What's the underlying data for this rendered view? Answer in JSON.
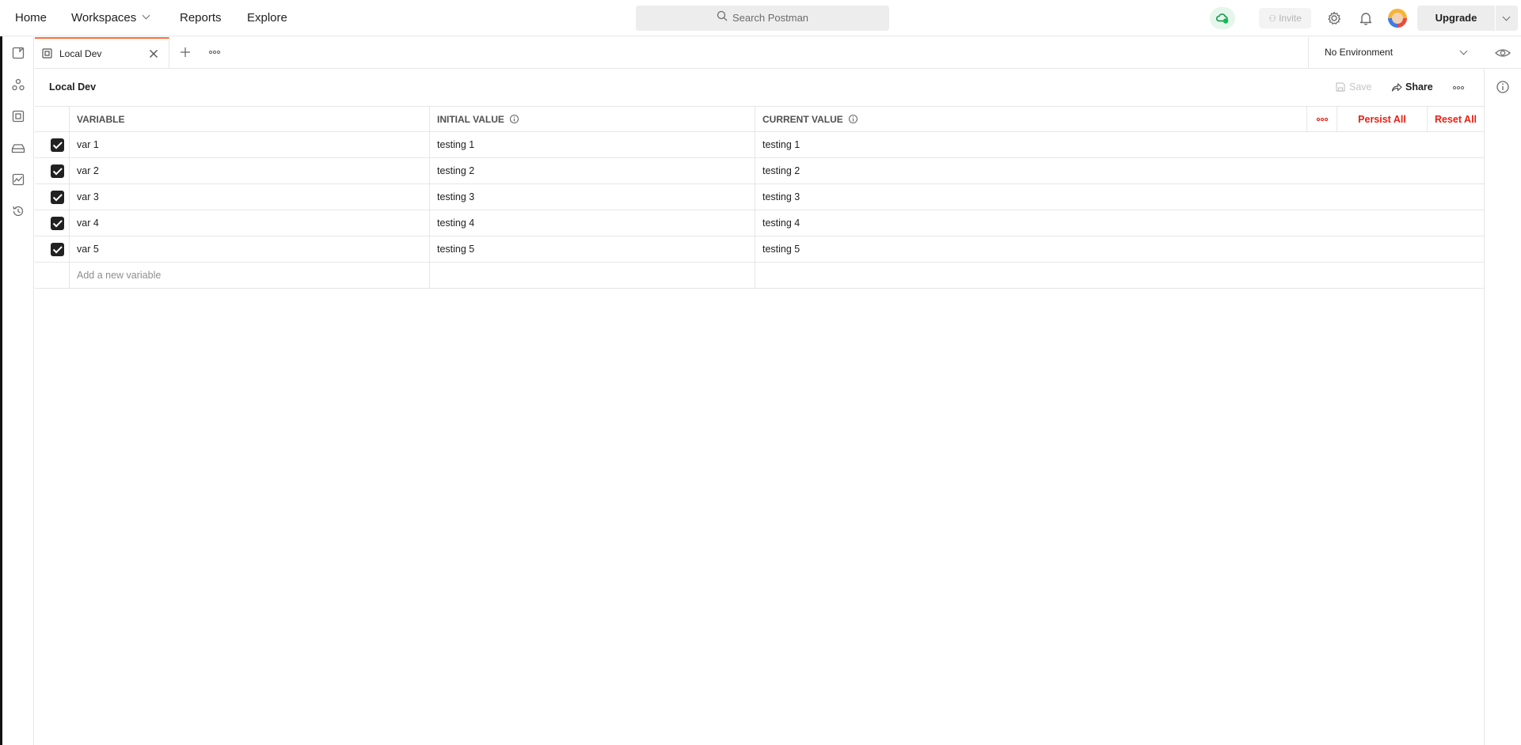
{
  "nav": {
    "home": "Home",
    "workspaces": "Workspaces",
    "reports": "Reports",
    "explore": "Explore",
    "search_placeholder": "Search Postman",
    "invite": "Invite",
    "upgrade": "Upgrade"
  },
  "tab": {
    "label": "Local Dev"
  },
  "environment_selector": {
    "selected": "No Environment"
  },
  "environment": {
    "title": "Local Dev",
    "save": "Save",
    "share": "Share"
  },
  "table": {
    "headers": {
      "variable": "VARIABLE",
      "initial_value": "INITIAL VALUE",
      "current_value": "CURRENT VALUE"
    },
    "actions": {
      "persist_all": "Persist All",
      "reset_all": "Reset All"
    },
    "rows": [
      {
        "variable": "var 1",
        "initial": "testing 1",
        "current": "testing 1",
        "enabled": true
      },
      {
        "variable": "var 2",
        "initial": "testing 2",
        "current": "testing 2",
        "enabled": true
      },
      {
        "variable": "var 3",
        "initial": "testing 3",
        "current": "testing 3",
        "enabled": true
      },
      {
        "variable": "var 4",
        "initial": "testing 4",
        "current": "testing 4",
        "enabled": true
      },
      {
        "variable": "var 5",
        "initial": "testing 5",
        "current": "testing 5",
        "enabled": true
      }
    ],
    "new_variable_placeholder": "Add a new variable"
  },
  "colors": {
    "accent": "#ff6c37",
    "danger": "#eb2013",
    "sync_ok": "#0cbb52"
  },
  "icons": [
    "search-icon",
    "cloud-sync-icon",
    "person-add-icon",
    "gear-icon",
    "bell-icon",
    "close-icon",
    "plus-icon",
    "ellipsis-icon",
    "eye-icon",
    "info-icon",
    "save-icon",
    "share-icon",
    "collections-icon",
    "apis-icon",
    "environments-icon",
    "mock-servers-icon",
    "monitors-icon",
    "history-icon"
  ]
}
